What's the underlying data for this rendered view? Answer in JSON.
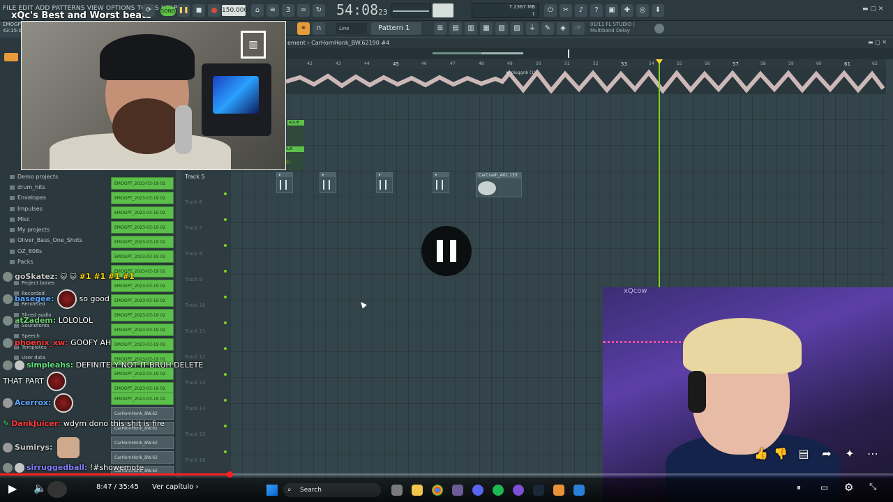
{
  "menu": {
    "items": [
      "FILE",
      "EDIT",
      "ADD",
      "PATTERNS",
      "VIEW",
      "OPTIONS",
      "TOOLS",
      "HELP"
    ]
  },
  "stream": {
    "title": "xQc's Best and Worst beats"
  },
  "project": {
    "file": "EMOGPT.flp",
    "time": "43:15:08"
  },
  "transport": {
    "song_label": "SONG",
    "tempo": "150.000",
    "clock_main": "54:08",
    "clock_sub": "23",
    "cpu_line1": "7     2367 MB",
    "cpu_line2": "1"
  },
  "toolbar2": {
    "snap": "Line",
    "pattern": "Pattern 1",
    "hint_line1": "01/11  FL STUDIO |",
    "hint_line2": "Multiband Delay"
  },
  "playlist": {
    "title": "ement › CarHornHonk_BW.62190 #4",
    "ruler": [
      "42",
      "43",
      "44",
      "45",
      "46",
      "47",
      "48",
      "49",
      "50",
      "51",
      "52",
      "53",
      "54",
      "55",
      "56",
      "57",
      "58",
      "59",
      "60",
      "61",
      "62"
    ],
    "plugin_label": "pluggnb (1)",
    "tracks": [
      {
        "label": "Track 5",
        "active": true
      },
      {
        "label": "Track 6",
        "active": false
      },
      {
        "label": "Track 7",
        "active": false
      },
      {
        "label": "Track 8",
        "active": false
      },
      {
        "label": "Track 9",
        "active": false
      },
      {
        "label": "Track 10",
        "active": false
      },
      {
        "label": "Track 11",
        "active": false
      },
      {
        "label": "Track 12",
        "active": false
      },
      {
        "label": "Track 13",
        "active": false
      },
      {
        "label": "Track 14",
        "active": false
      },
      {
        "label": "Track 15",
        "active": false
      },
      {
        "label": "Track 16",
        "active": false
      }
    ],
    "clip_adlib_1": "ADLIB",
    "clip_adlib_2": "YGO ADLIB",
    "carcrash": "CarCrash_A01.133"
  },
  "patterns": {
    "items": [
      "EMOGPT_2023-03-19 02",
      "EMOGPT_2023-03-19 02",
      "EMOGPT_2023-03-19 02",
      "EMOGPT_2023-03-19 02",
      "EMOGPT_2023-03-19 02",
      "EMOGPT_2023-03-19 02",
      "EMOGPT_2023-03-19 02",
      "EMOGPT_2023-03-19 02",
      "EMOGPT_2023-03-19 02",
      "EMOGPT_2023-03-19 02",
      "EMOGPT_2023-03-19 02",
      "EMOGPT_2023-03-19 02",
      "EMOGPT_2023-03-19 02",
      "EMOGPT_2023-03-19 02",
      "EMOGPT_2023-03-19 02",
      "EMOGPT_2023-03-19 02"
    ],
    "grey_items": [
      "CarHornHonk_BW.62",
      "CarHornHonk_BW.62",
      "CarHornHonk_BW.62",
      "CarHornHonk_BW.62",
      "CarHornHonk_BW.62"
    ]
  },
  "browser": {
    "items": [
      "Demo projects",
      "drum_hits",
      "Envelopes",
      "Impulses",
      "Misc",
      "My projects",
      "Oliver_Bass_One_Shots",
      "OZ_808s",
      "Packs",
      "Project bones",
      "Recorded",
      "Rendered",
      "Sliced audio",
      "Soundfonts",
      "Speech",
      "Templates",
      "User data"
    ]
  },
  "chat": [
    {
      "user": "goSkatez:",
      "color": "#c9c9c9",
      "text": "#1 #1 #1 #1",
      "text_color": "#ffd400"
    },
    {
      "user": "basegee:",
      "color": "#5aa7ff",
      "text": "so good",
      "text_color": "#ffffff"
    },
    {
      "user": "atZadem:",
      "color": "#6fcf6f",
      "text": "LOLOLOL",
      "text_color": "#ffffff"
    },
    {
      "user": "phoenix_xw:",
      "color": "#ff3b3b",
      "text": "GOOFY AH",
      "text_color": "#ffffff"
    },
    {
      "user": "simpleahs:",
      "color": "#5fe07a",
      "text": "DEFINITELY NOT IT BRUH DELETE",
      "text_color": "#ffffff"
    },
    {
      "user": "",
      "color": "#ffffff",
      "text": "THAT PART",
      "text_color": "#ffffff"
    },
    {
      "user": "Acerrox:",
      "color": "#5aa7ff",
      "text": "",
      "text_color": "#ffffff"
    },
    {
      "user": "DankJuicer:",
      "color": "#ff3b3b",
      "text": "wdym dono this shit is fire",
      "text_color": "#ffffff"
    },
    {
      "user": "Sumirys:",
      "color": "#c9c9c9",
      "text": "",
      "text_color": "#ffffff"
    },
    {
      "user": "sirruggedball:",
      "color": "#8a7dff",
      "text": "!#showemote",
      "text_color": "#ffffff"
    }
  ],
  "cam2": {
    "watermark": "xQcow"
  },
  "video": {
    "time": "8:47 / 35:45",
    "chapter": "Ver capítulo",
    "search": "Search"
  }
}
